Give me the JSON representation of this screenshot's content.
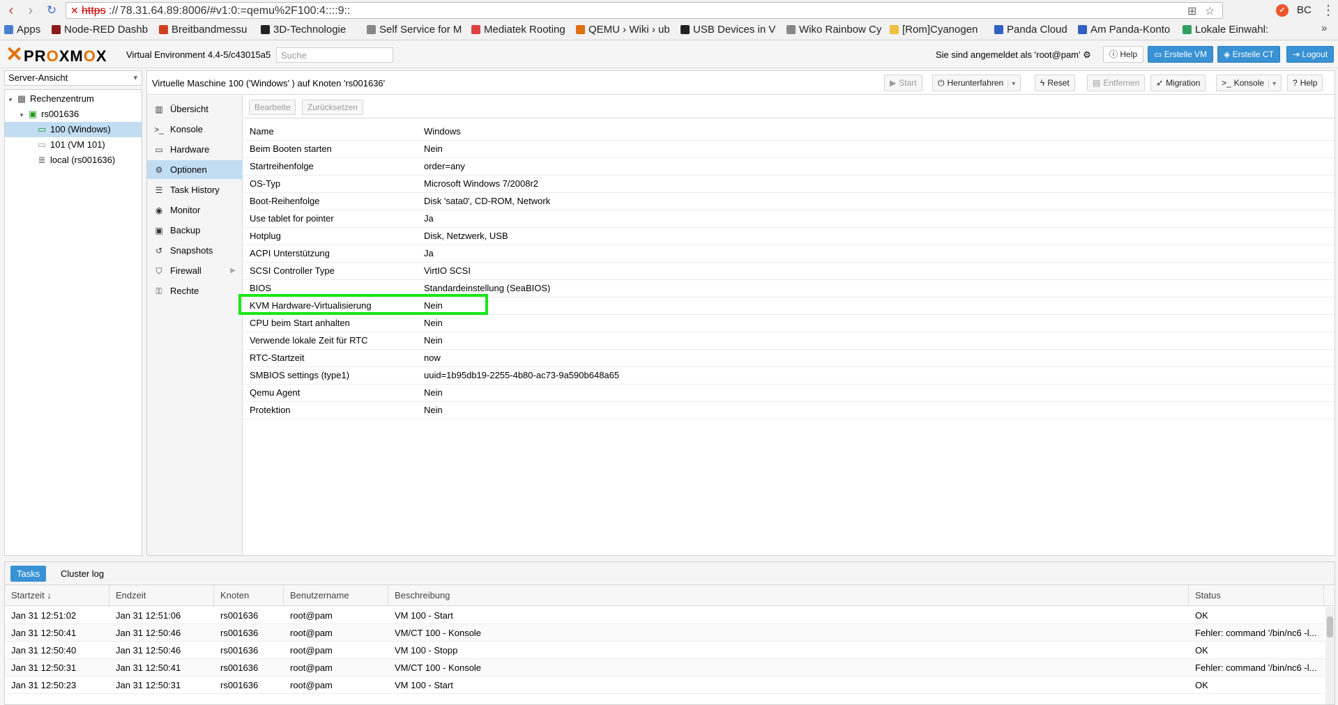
{
  "browser": {
    "url_scheme": "https",
    "url_rest": "78.31.64.89:8006/#v1:0:=qemu%2F100:4::::9::",
    "profile": "BC",
    "bookmarks": [
      {
        "label": "Apps",
        "color": "#4a7fd0"
      },
      {
        "label": "Node-RED Dashb",
        "color": "#8b1a1a"
      },
      {
        "label": "Breitbandmessu",
        "color": "#d04020"
      },
      {
        "label": "3D-Technologie",
        "color": "#222222"
      },
      {
        "label": "Self Service for M",
        "color": "#888888"
      },
      {
        "label": "Mediatek Rooting",
        "color": "#e04040"
      },
      {
        "label": "QEMU › Wiki › ub",
        "color": "#e07010"
      },
      {
        "label": "USB Devices in V",
        "color": "#222222"
      },
      {
        "label": "Wiko Rainbow Cy",
        "color": "#888888"
      },
      {
        "label": "[Rom]Cyanogen",
        "color": "#f0c040"
      },
      {
        "label": "Panda Cloud",
        "color": "#3060c0"
      },
      {
        "label": "Am Panda-Konto",
        "color": "#3060c0"
      },
      {
        "label": "Lokale Einwahl: ",
        "color": "#30a060"
      }
    ]
  },
  "header": {
    "logo_x": "✕",
    "logo_pr": "PR",
    "logo_o1": "O",
    "logo_xm": "XM",
    "logo_o2": "O",
    "logo_end": "X",
    "version": "Virtual Environment 4.4-5/c43015a5",
    "search_placeholder": "Suche",
    "logged_in": "Sie sind angemeldet als 'root@pam'",
    "help": "Help",
    "create_vm": "Erstelle VM",
    "create_ct": "Erstelle CT",
    "logout": "Logout"
  },
  "tree": {
    "view": "Server-Ansicht",
    "datacenter": "Rechenzentrum",
    "node": "rs001636",
    "vm_selected": "100 (Windows)",
    "vm_other": "101 (VM 101)",
    "storage": "local (rs001636)"
  },
  "panel": {
    "title": "Virtuelle Maschine 100 ('Windows' ) auf Knoten 'rs001636'",
    "toolbar": {
      "start": "Start",
      "shutdown": "Herunterfahren",
      "reset": "Reset",
      "remove": "Entfernen",
      "migrate": "Migration",
      "console": "Konsole",
      "help": "Help"
    },
    "menu": [
      "Übersicht",
      "Konsole",
      "Hardware",
      "Optionen",
      "Task History",
      "Monitor",
      "Backup",
      "Snapshots",
      "Firewall",
      "Rechte"
    ],
    "grid_buttons": {
      "edit": "Bearbeite",
      "revert": "Zurücksetzen"
    },
    "options": [
      {
        "key": "Name",
        "value": "Windows"
      },
      {
        "key": "Beim Booten starten",
        "value": "Nein"
      },
      {
        "key": "Startreihenfolge",
        "value": "order=any"
      },
      {
        "key": "OS-Typ",
        "value": "Microsoft Windows 7/2008r2"
      },
      {
        "key": "Boot-Reihenfolge",
        "value": "Disk 'sata0', CD-ROM, Network"
      },
      {
        "key": "Use tablet for pointer",
        "value": "Ja"
      },
      {
        "key": "Hotplug",
        "value": "Disk, Netzwerk, USB"
      },
      {
        "key": "ACPI Unterstützung",
        "value": "Ja"
      },
      {
        "key": "SCSI Controller Type",
        "value": "VirtIO SCSI"
      },
      {
        "key": "BIOS",
        "value": "Standardeinstellung (SeaBIOS)"
      },
      {
        "key": "KVM Hardware-Virtualisierung",
        "value": "Nein"
      },
      {
        "key": "CPU beim Start anhalten",
        "value": "Nein"
      },
      {
        "key": "Verwende lokale Zeit für RTC",
        "value": "Nein"
      },
      {
        "key": "RTC-Startzeit",
        "value": "now"
      },
      {
        "key": "SMBIOS settings (type1)",
        "value": "uuid=1b95db19-2255-4b80-ac73-9a590b648a65"
      },
      {
        "key": "Qemu Agent",
        "value": "Nein"
      },
      {
        "key": "Protektion",
        "value": "Nein"
      }
    ]
  },
  "tasks": {
    "tabs": [
      "Tasks",
      "Cluster log"
    ],
    "columns": [
      "Startzeit ↓",
      "Endzeit",
      "Knoten",
      "Benutzername",
      "Beschreibung",
      "Status"
    ],
    "rows": [
      [
        "Jan 31 12:51:02",
        "Jan 31 12:51:06",
        "rs001636",
        "root@pam",
        "VM 100 - Start",
        "OK"
      ],
      [
        "Jan 31 12:50:41",
        "Jan 31 12:50:46",
        "rs001636",
        "root@pam",
        "VM/CT 100 - Konsole",
        "Fehler: command '/bin/nc6 -l..."
      ],
      [
        "Jan 31 12:50:40",
        "Jan 31 12:50:46",
        "rs001636",
        "root@pam",
        "VM 100 - Stopp",
        "OK"
      ],
      [
        "Jan 31 12:50:31",
        "Jan 31 12:50:41",
        "rs001636",
        "root@pam",
        "VM/CT 100 - Konsole",
        "Fehler: command '/bin/nc6 -l..."
      ],
      [
        "Jan 31 12:50:23",
        "Jan 31 12:50:31",
        "rs001636",
        "root@pam",
        "VM 100 - Start",
        "OK"
      ]
    ]
  }
}
